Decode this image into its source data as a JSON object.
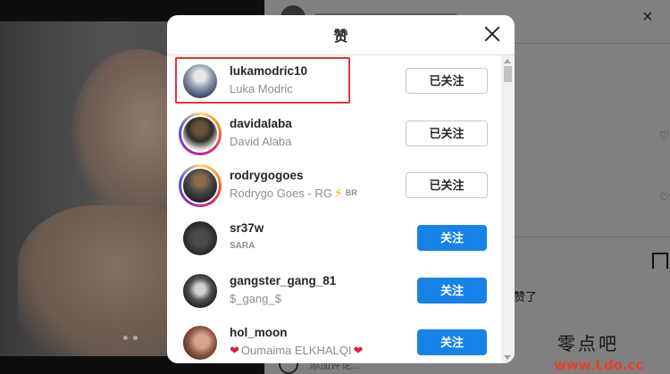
{
  "background": {
    "liked_text": "赞了",
    "comment_placeholder": "添加评论..."
  },
  "modal": {
    "title": "赞",
    "close_icon": "close-icon"
  },
  "users": [
    {
      "username": "lukamodric10",
      "fullname": "Luka Modric",
      "button": "已关注",
      "following": true,
      "story_ring": false,
      "highlighted": true
    },
    {
      "username": "davidalaba",
      "fullname": "David Alaba",
      "button": "已关注",
      "following": true,
      "story_ring": true
    },
    {
      "username": "rodrygogoes",
      "fullname": "Rodrygo Goes - RG",
      "fullname_badge_icon": "lightning-icon",
      "fullname_badge": "BR",
      "button": "已关注",
      "following": true,
      "story_ring": true
    },
    {
      "username": "sr37w",
      "fullname": "SARA",
      "button": "关注",
      "following": false,
      "story_ring": false
    },
    {
      "username": "gangster_gang_81",
      "fullname": "$_gang_$",
      "button": "关注",
      "following": false,
      "story_ring": false
    },
    {
      "username": "hol_moon",
      "fullname": "Oumaima ELKHALQI",
      "fullname_icons": [
        "heart-icon",
        "heart-icon"
      ],
      "button": "关注",
      "following": false,
      "story_ring": false
    }
  ],
  "watermark": {
    "main": "零点吧",
    "url": "www.Ldo.cc"
  },
  "colors": {
    "follow_button": "#1783e8",
    "highlight_box": "#e0353a",
    "story_ring": "#d62976"
  }
}
